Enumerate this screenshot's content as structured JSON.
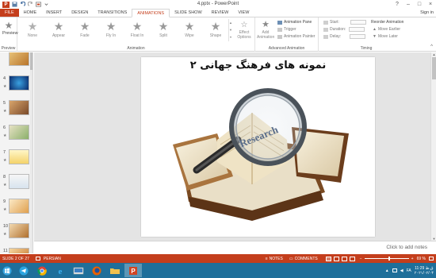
{
  "window": {
    "title": "4.pptx - PowerPoint",
    "controls": [
      "?",
      "–",
      "□",
      "×"
    ]
  },
  "ribbon_tabs": {
    "file": "FILE",
    "items": [
      "HOME",
      "INSERT",
      "DESIGN",
      "TRANSITIONS",
      "ANIMATIONS",
      "SLIDE SHOW",
      "REVIEW",
      "VIEW"
    ],
    "active": "ANIMATIONS",
    "signin": "Sign in"
  },
  "ribbon": {
    "preview": {
      "label": "Preview",
      "group": "Preview"
    },
    "animation": {
      "group": "Animation",
      "effects": [
        "None",
        "Appear",
        "Fade",
        "Fly In",
        "Float In",
        "Split",
        "Wipe",
        "Shape"
      ],
      "effect_options": "Effect Options"
    },
    "advanced": {
      "group": "Advanced Animation",
      "add_animation": "Add Animation",
      "animation_pane": "Animation Pane",
      "trigger": "Trigger",
      "animation_painter": "Animation Painter"
    },
    "timing": {
      "group": "Timing",
      "start": "Start:",
      "duration": "Duration:",
      "delay": "Delay:",
      "reorder_title": "Reorder Animation",
      "move_earlier": "Move Earlier",
      "move_later": "Move Later"
    }
  },
  "thumbnails": [
    "3",
    "4",
    "5",
    "6",
    "7",
    "8",
    "9",
    "10",
    "11"
  ],
  "slide": {
    "title": "نمونه های فرهنگ جهانی ۲",
    "book_label": "Research"
  },
  "notes": {
    "placeholder": "Click to add notes"
  },
  "status": {
    "slide_info": "SLIDE 2 OF 27",
    "language": "PERSIAN",
    "notes": "NOTES",
    "comments": "COMMENTS",
    "zoom": "69 %"
  },
  "taskbar": {
    "lang": "FA",
    "time": "11:29 ق.ظ",
    "date": "۲۰۲۱/۰۲/۰۴",
    "apps": [
      "telegram-icon",
      "chrome-icon",
      "ie-icon",
      "explorer-icon",
      "firefox-icon",
      "folder-icon",
      "powerpoint-icon"
    ]
  },
  "colors": {
    "accent": "#c43e1c",
    "taskbar": "#1f6f9a"
  }
}
